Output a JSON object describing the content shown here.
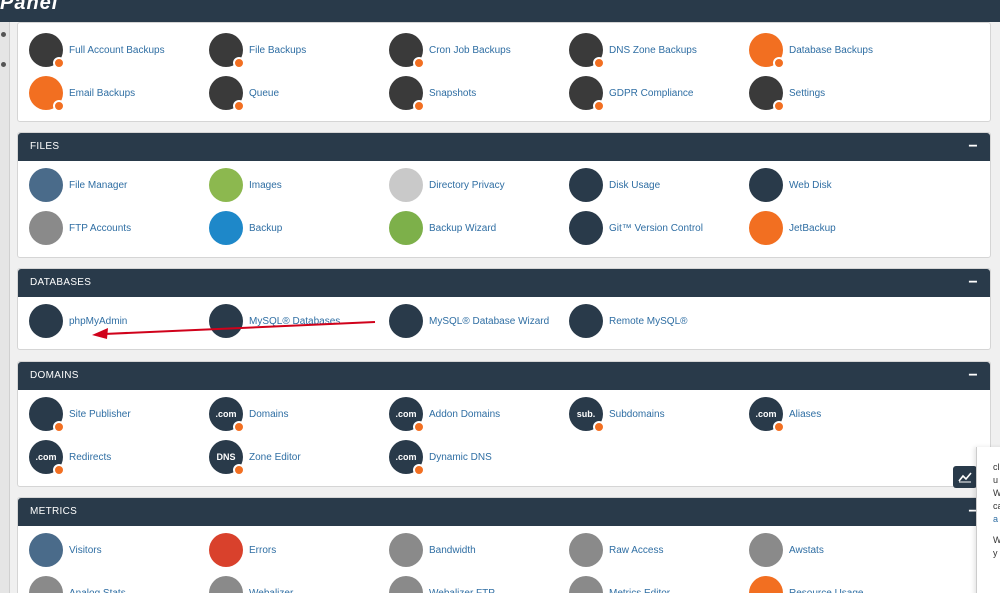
{
  "brand": "Panel",
  "sections": {
    "backup": {
      "items": [
        {
          "label": "Full Account Backups",
          "icon": "user-backup-icon",
          "color": "#3a3a3a"
        },
        {
          "label": "File Backups",
          "icon": "file-backup-icon",
          "color": "#3a3a3a"
        },
        {
          "label": "Cron Job Backups",
          "icon": "cron-backup-icon",
          "color": "#3a3a3a"
        },
        {
          "label": "DNS Zone Backups",
          "icon": "dns-backup-icon",
          "color": "#3a3a3a"
        },
        {
          "label": "Database Backups",
          "icon": "database-backup-icon",
          "color": "#f26f21"
        },
        {
          "label": "Email Backups",
          "icon": "email-backup-icon",
          "color": "#f26f21"
        },
        {
          "label": "Queue",
          "icon": "queue-icon",
          "color": "#3a3a3a"
        },
        {
          "label": "Snapshots",
          "icon": "snapshot-icon",
          "color": "#3a3a3a"
        },
        {
          "label": "GDPR Compliance",
          "icon": "gdpr-icon",
          "color": "#3a3a3a"
        },
        {
          "label": "Settings",
          "icon": "settings-icon",
          "color": "#3a3a3a"
        }
      ]
    },
    "files": {
      "title": "FILES",
      "items": [
        {
          "label": "File Manager",
          "icon": "file-manager-icon",
          "color": "#4a6b8a"
        },
        {
          "label": "Images",
          "icon": "images-icon",
          "color": "#8cb84f"
        },
        {
          "label": "Directory Privacy",
          "icon": "directory-privacy-icon",
          "color": "#c9c9c9"
        },
        {
          "label": "Disk Usage",
          "icon": "disk-usage-icon",
          "color": "#293a4a"
        },
        {
          "label": "Web Disk",
          "icon": "web-disk-icon",
          "color": "#293a4a"
        },
        {
          "label": "FTP Accounts",
          "icon": "ftp-accounts-icon",
          "color": "#8a8a8a"
        },
        {
          "label": "Backup",
          "icon": "backup-icon",
          "color": "#1e88c9"
        },
        {
          "label": "Backup Wizard",
          "icon": "backup-wizard-icon",
          "color": "#7db04a"
        },
        {
          "label": "Git™ Version Control",
          "icon": "git-icon",
          "color": "#293a4a"
        },
        {
          "label": "JetBackup",
          "icon": "jetbackup-icon",
          "color": "#f26f21"
        }
      ]
    },
    "databases": {
      "title": "DATABASES",
      "items": [
        {
          "label": "phpMyAdmin",
          "icon": "phpmyadmin-icon",
          "color": "#293a4a"
        },
        {
          "label": "MySQL® Databases",
          "icon": "mysql-databases-icon",
          "color": "#293a4a"
        },
        {
          "label": "MySQL® Database Wizard",
          "icon": "mysql-wizard-icon",
          "color": "#293a4a"
        },
        {
          "label": "Remote MySQL®",
          "icon": "remote-mysql-icon",
          "color": "#293a4a"
        }
      ]
    },
    "domains": {
      "title": "DOMAINS",
      "items": [
        {
          "label": "Site Publisher",
          "icon": "site-publisher-icon",
          "color": "#293a4a",
          "glyph": ""
        },
        {
          "label": "Domains",
          "icon": "domains-icon",
          "color": "#293a4a",
          "glyph": ".com"
        },
        {
          "label": "Addon Domains",
          "icon": "addon-domains-icon",
          "color": "#293a4a",
          "glyph": ".com"
        },
        {
          "label": "Subdomains",
          "icon": "subdomains-icon",
          "color": "#293a4a",
          "glyph": "sub."
        },
        {
          "label": "Aliases",
          "icon": "aliases-icon",
          "color": "#293a4a",
          "glyph": ".com"
        },
        {
          "label": "Redirects",
          "icon": "redirects-icon",
          "color": "#293a4a",
          "glyph": ".com"
        },
        {
          "label": "Zone Editor",
          "icon": "zone-editor-icon",
          "color": "#293a4a",
          "glyph": "DNS"
        },
        {
          "label": "Dynamic DNS",
          "icon": "dynamic-dns-icon",
          "color": "#293a4a",
          "glyph": ".com"
        }
      ]
    },
    "metrics": {
      "title": "METRICS",
      "items": [
        {
          "label": "Visitors",
          "icon": "visitors-icon",
          "color": "#4a6b8a"
        },
        {
          "label": "Errors",
          "icon": "errors-icon",
          "color": "#d9412c"
        },
        {
          "label": "Bandwidth",
          "icon": "bandwidth-icon",
          "color": "#8a8a8a"
        },
        {
          "label": "Raw Access",
          "icon": "raw-access-icon",
          "color": "#8a8a8a"
        },
        {
          "label": "Awstats",
          "icon": "awstats-icon",
          "color": "#8a8a8a"
        },
        {
          "label": "Analog Stats",
          "icon": "analog-stats-icon",
          "color": "#8a8a8a"
        },
        {
          "label": "Webalizer",
          "icon": "webalizer-icon",
          "color": "#8a8a8a"
        },
        {
          "label": "Webalizer FTP",
          "icon": "webalizer-ftp-icon",
          "color": "#8a8a8a"
        },
        {
          "label": "Metrics Editor",
          "icon": "metrics-editor-icon",
          "color": "#8a8a8a"
        },
        {
          "label": "Resource Usage",
          "icon": "resource-usage-icon",
          "color": "#f26f21"
        }
      ]
    }
  },
  "collapse_symbol": "−",
  "side_widget": {
    "lines": [
      "cl",
      "u",
      "W",
      "ca",
      "a",
      "W",
      "y"
    ]
  }
}
